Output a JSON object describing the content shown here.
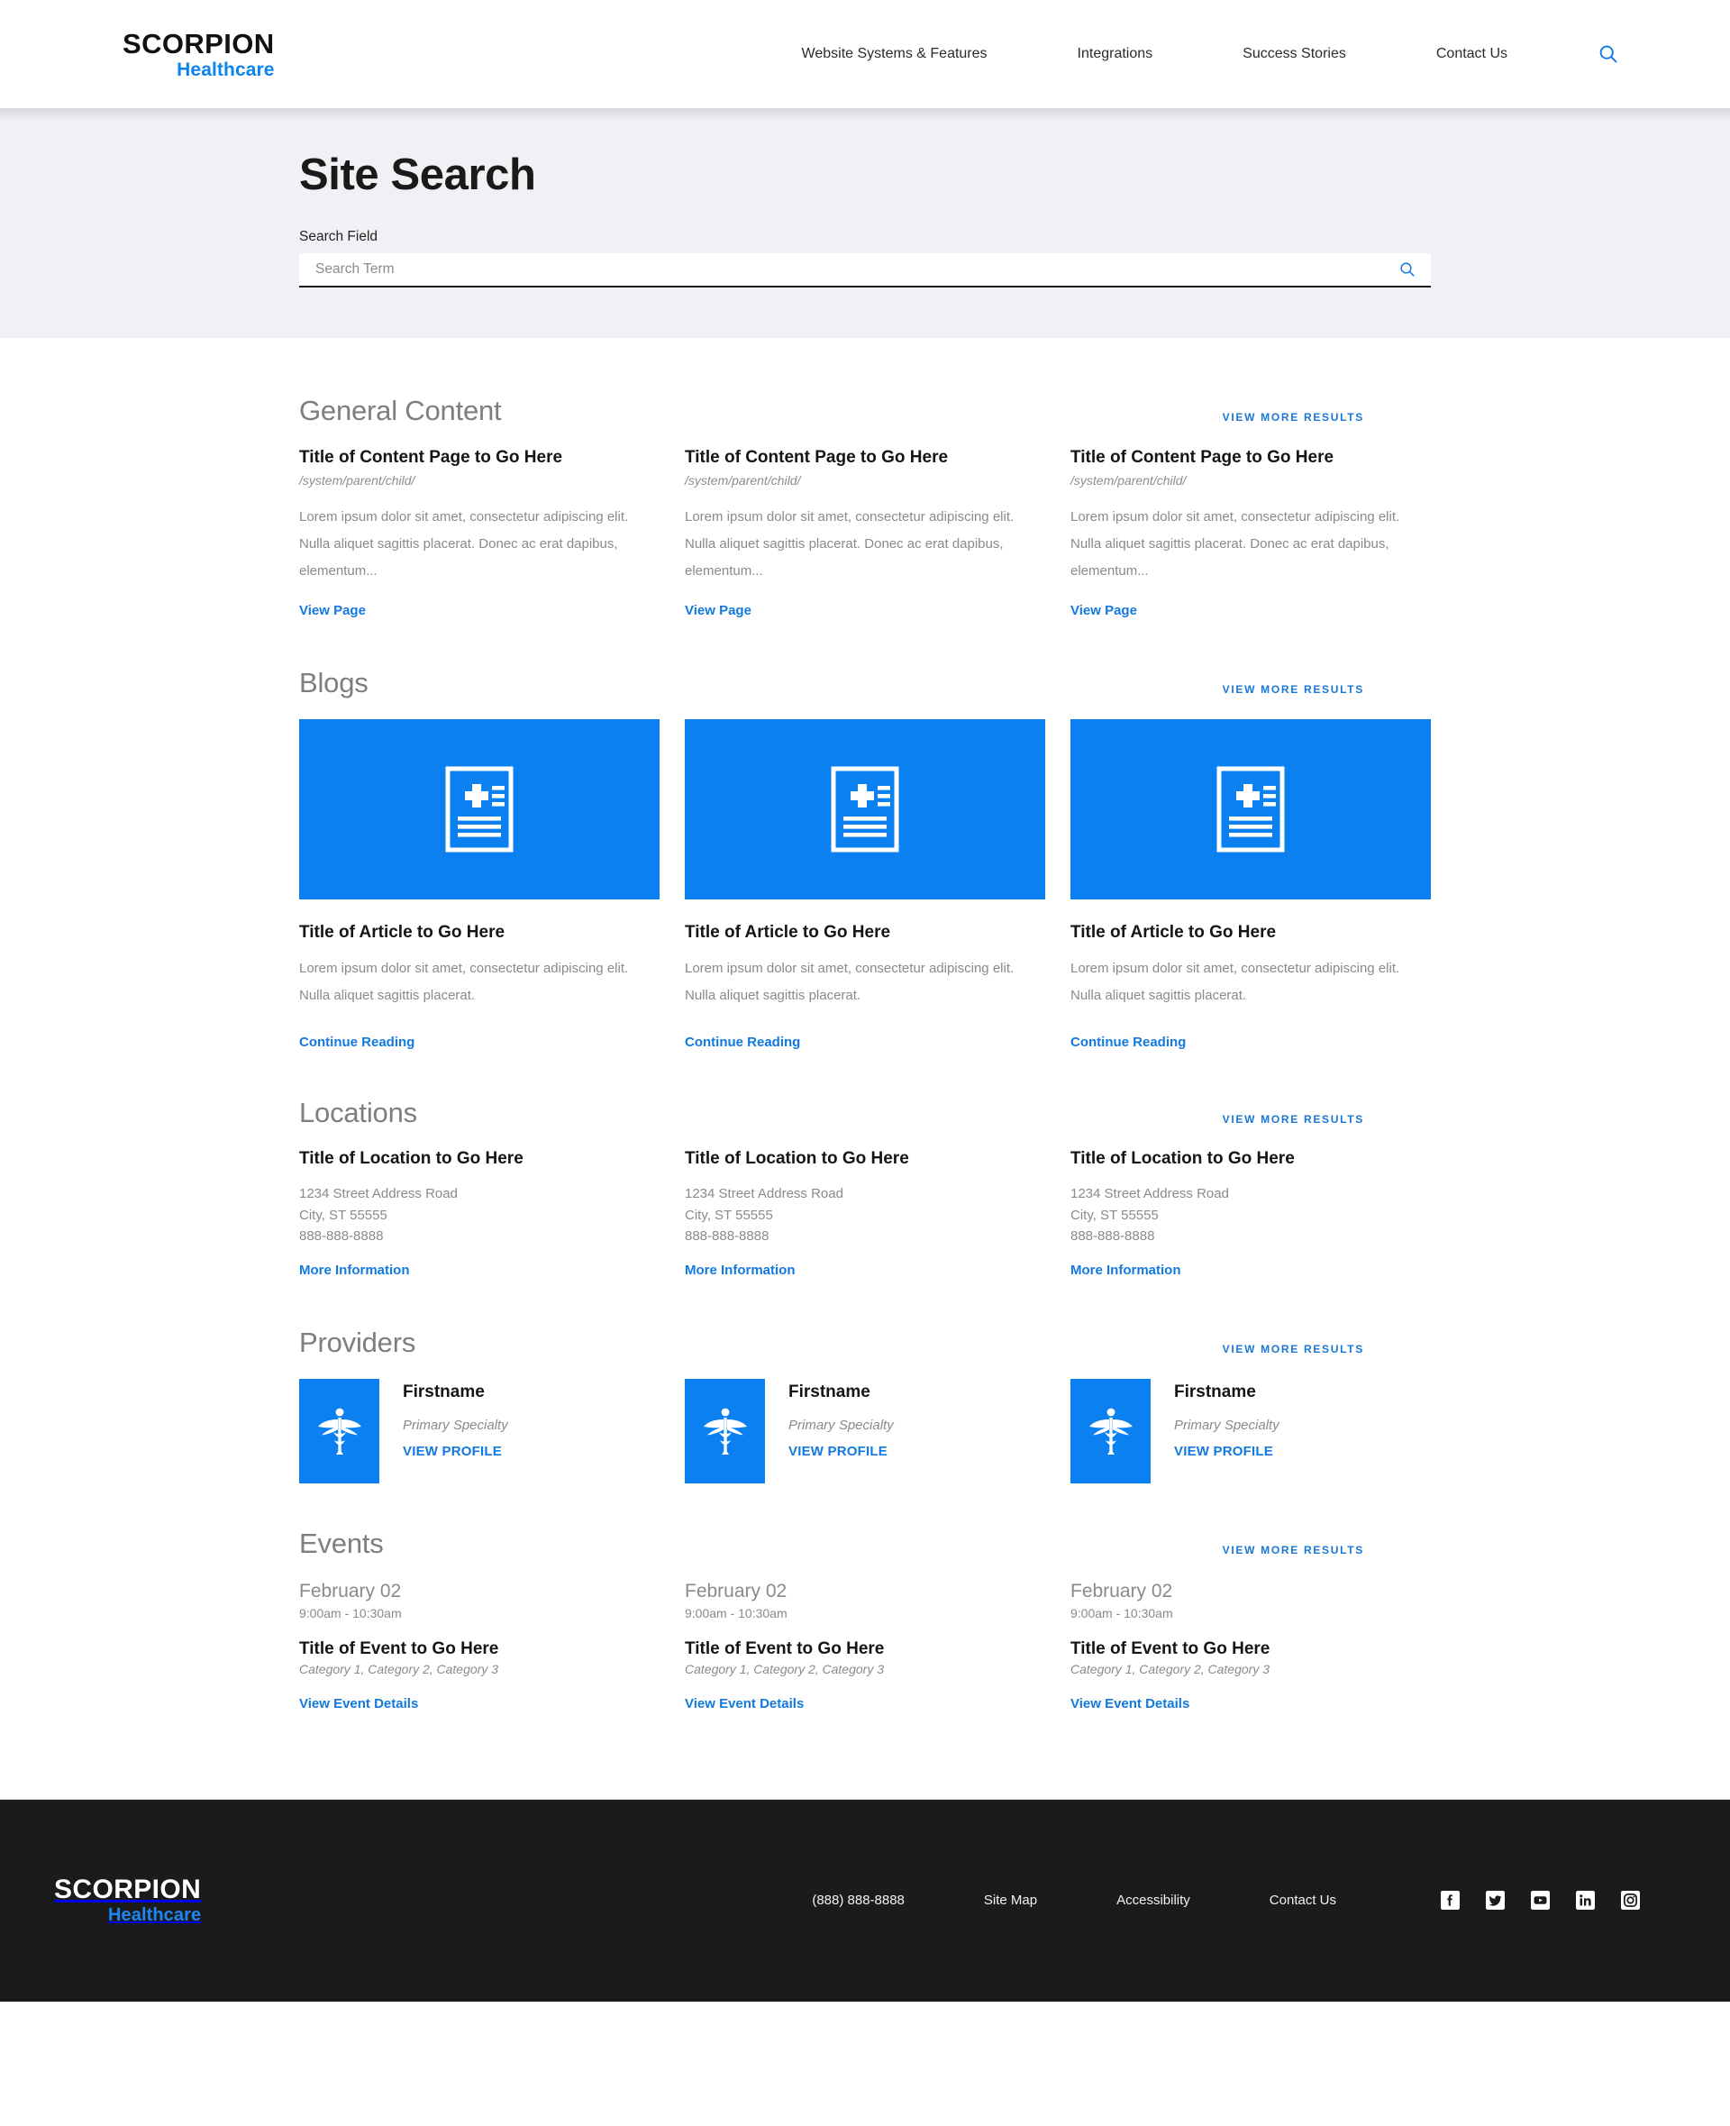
{
  "header": {
    "logo": {
      "main": "SCORPION",
      "sub": "Healthcare"
    },
    "nav": [
      {
        "label": "Website Systems & Features"
      },
      {
        "label": "Integrations"
      },
      {
        "label": "Success Stories"
      },
      {
        "label": "Contact Us"
      }
    ],
    "search_icon": "search-icon"
  },
  "hero": {
    "title": "Site Search",
    "field_label": "Search Field",
    "search_placeholder": "Search Term",
    "search_value": "",
    "submit_icon": "search-icon"
  },
  "view_more_label": "VIEW MORE RESULTS",
  "sections": {
    "general_content": {
      "title": "General Content",
      "view_more": "VIEW MORE RESULTS",
      "items": [
        {
          "title": "Title of Content Page to Go Here",
          "path": "/system/parent/child/",
          "excerpt": "Lorem ipsum dolor sit amet, consectetur adipiscing elit. Nulla aliquet sagittis placerat. Donec ac erat dapibus, elementum...",
          "link": "View Page"
        },
        {
          "title": "Title of Content Page to Go Here",
          "path": "/system/parent/child/",
          "excerpt": "Lorem ipsum dolor sit amet, consectetur adipiscing elit. Nulla aliquet sagittis placerat. Donec ac erat dapibus, elementum...",
          "link": "View Page"
        },
        {
          "title": "Title of Content Page to Go Here",
          "path": "/system/parent/child/",
          "excerpt": "Lorem ipsum dolor sit amet, consectetur adipiscing elit. Nulla aliquet sagittis placerat. Donec ac erat dapibus, elementum...",
          "link": "View Page"
        }
      ]
    },
    "blogs": {
      "title": "Blogs",
      "view_more": "VIEW MORE RESULTS",
      "thumb_icon": "medical-document-icon",
      "items": [
        {
          "title": "Title of Article to Go Here",
          "excerpt": "Lorem ipsum dolor sit amet, consectetur adipiscing elit. Nulla aliquet sagittis placerat.",
          "link": "Continue Reading"
        },
        {
          "title": "Title of Article to Go Here",
          "excerpt": "Lorem ipsum dolor sit amet, consectetur adipiscing elit. Nulla aliquet sagittis placerat.",
          "link": "Continue Reading"
        },
        {
          "title": "Title of Article to Go Here",
          "excerpt": "Lorem ipsum dolor sit amet, consectetur adipiscing elit. Nulla aliquet sagittis placerat.",
          "link": "Continue Reading"
        }
      ]
    },
    "locations": {
      "title": "Locations",
      "view_more": "VIEW MORE RESULTS",
      "items": [
        {
          "title": "Title of Location to Go Here",
          "street": "1234 Street Address Road",
          "city": "City, ST 55555",
          "phone": "888-888-8888",
          "link": "More Information"
        },
        {
          "title": "Title of Location to Go Here",
          "street": "1234 Street Address Road",
          "city": "City, ST 55555",
          "phone": "888-888-8888",
          "link": "More Information"
        },
        {
          "title": "Title of Location to Go Here",
          "street": "1234 Street Address Road",
          "city": "City, ST 55555",
          "phone": "888-888-8888",
          "link": "More Information"
        }
      ]
    },
    "providers": {
      "title": "Providers",
      "view_more": "VIEW MORE RESULTS",
      "tile_icon": "caduceus-icon",
      "items": [
        {
          "name": "Firstname",
          "specialty": "Primary Specialty",
          "link": "VIEW PROFILE"
        },
        {
          "name": "Firstname",
          "specialty": "Primary Specialty",
          "link": "VIEW PROFILE"
        },
        {
          "name": "Firstname",
          "specialty": "Primary Specialty",
          "link": "VIEW PROFILE"
        }
      ]
    },
    "events": {
      "title": "Events",
      "view_more": "VIEW MORE RESULTS",
      "items": [
        {
          "date": "February 02",
          "time": "9:00am - 10:30am",
          "title": "Title of Event to Go Here",
          "categories": "Category 1, Category 2, Category 3",
          "link": "View Event Details"
        },
        {
          "date": "February 02",
          "time": "9:00am - 10:30am",
          "title": "Title of Event to Go Here",
          "categories": "Category 1, Category 2, Category 3",
          "link": "View Event Details"
        },
        {
          "date": "February 02",
          "time": "9:00am - 10:30am",
          "title": "Title of Event to Go Here",
          "categories": "Category 1, Category 2, Category 3",
          "link": "View Event Details"
        }
      ]
    }
  },
  "footer": {
    "logo": {
      "main": "SCORPION",
      "sub": "Healthcare"
    },
    "links": [
      {
        "label": "(888) 888-8888"
      },
      {
        "label": "Site Map"
      },
      {
        "label": "Accessibility"
      },
      {
        "label": "Contact Us"
      }
    ],
    "social": [
      {
        "name": "facebook-icon"
      },
      {
        "name": "twitter-icon"
      },
      {
        "name": "youtube-icon"
      },
      {
        "name": "linkedin-icon"
      },
      {
        "name": "instagram-icon"
      }
    ]
  },
  "colors": {
    "accent_blue": "#0a80f1",
    "link_blue": "#1279e0",
    "hero_bg": "#f1f1f5",
    "footer_bg": "#1b1b1b",
    "muted_text": "#8a8a8e"
  }
}
